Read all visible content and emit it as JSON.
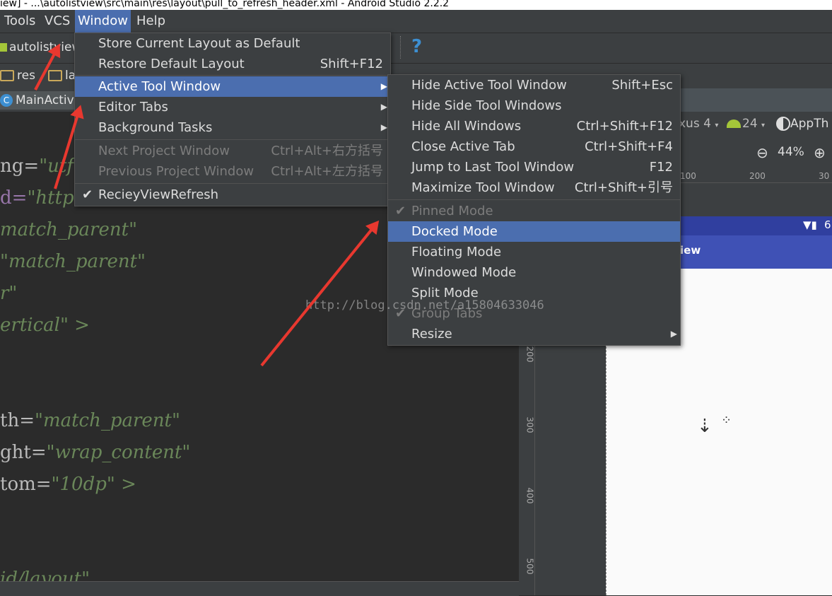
{
  "title_bar": "iew] - ...\\autolistview\\src\\main\\res\\layout\\pull_to_refresh_header.xml - Android Studio 2.2.2",
  "menubar": {
    "tools": "Tools",
    "vcs": "VCS",
    "window": "Window",
    "help": "Help"
  },
  "toolbar": {
    "project": "autolistview",
    "help_icon": "?"
  },
  "breadcrumb": {
    "res": "res",
    "layout": "la"
  },
  "editor_tab": "MainActiv",
  "editor_lines": [
    {
      "attr": "ng=",
      "value": "\"utf"
    },
    {
      "attr": "d=",
      "value": "\"http"
    },
    {
      "attr": "",
      "value": "match_parent\""
    },
    {
      "attr": "",
      "value": "\"match_parent\""
    },
    {
      "attr": "",
      "value": "r\""
    },
    {
      "attr": "",
      "value": "ertical\" >"
    },
    {
      "attr": "th=",
      "value": "\"match_parent\""
    },
    {
      "attr": "ght=",
      "value": "\"wrap_content\""
    },
    {
      "attr": "tom=",
      "value": "\"10dp\" >"
    },
    {
      "attr": "",
      "value": "id/layout\""
    }
  ],
  "preview": {
    "device": "xus 4",
    "api": "24",
    "theme": "AppTh",
    "zoom": "44%",
    "ruler_top": [
      "100",
      "200",
      "30"
    ],
    "ruler_left": [
      "200",
      "300",
      "400",
      "500"
    ],
    "app_title": "iew",
    "status_right": "6"
  },
  "window_menu": {
    "items": [
      {
        "label": "Store Current Layout as Default",
        "shortcut": ""
      },
      {
        "label": "Restore Default Layout",
        "shortcut": "Shift+F12"
      },
      {
        "label": "Active Tool Window",
        "shortcut": ""
      },
      {
        "label": "Editor Tabs",
        "shortcut": ""
      },
      {
        "label": "Background Tasks",
        "shortcut": ""
      },
      {
        "label": "Next Project Window",
        "shortcut": "Ctrl+Alt+右方括号"
      },
      {
        "label": "Previous Project Window",
        "shortcut": "Ctrl+Alt+左方括号"
      },
      {
        "label": "RecieyViewRefresh",
        "shortcut": ""
      }
    ]
  },
  "active_tool_menu": {
    "items": [
      {
        "label": "Hide Active Tool Window",
        "shortcut": "Shift+Esc"
      },
      {
        "label": "Hide Side Tool Windows",
        "shortcut": ""
      },
      {
        "label": "Hide All Windows",
        "shortcut": "Ctrl+Shift+F12"
      },
      {
        "label": "Close Active Tab",
        "shortcut": "Ctrl+Shift+F4"
      },
      {
        "label": "Jump to Last Tool Window",
        "shortcut": "F12"
      },
      {
        "label": "Maximize Tool Window",
        "shortcut": "Ctrl+Shift+引号"
      },
      {
        "label": "Pinned Mode",
        "shortcut": ""
      },
      {
        "label": "Docked Mode",
        "shortcut": ""
      },
      {
        "label": "Floating Mode",
        "shortcut": ""
      },
      {
        "label": "Windowed Mode",
        "shortcut": ""
      },
      {
        "label": "Split Mode",
        "shortcut": ""
      },
      {
        "label": "Group Tabs",
        "shortcut": ""
      },
      {
        "label": "Resize",
        "shortcut": ""
      }
    ]
  },
  "watermark": "http://blog.csdn.net/a15804633046",
  "colors": {
    "selection": "#4b6eaf",
    "menu_bg": "#3c3f41",
    "editor_bg": "#2b2b2b",
    "annotation_arrow": "#e8382f"
  }
}
